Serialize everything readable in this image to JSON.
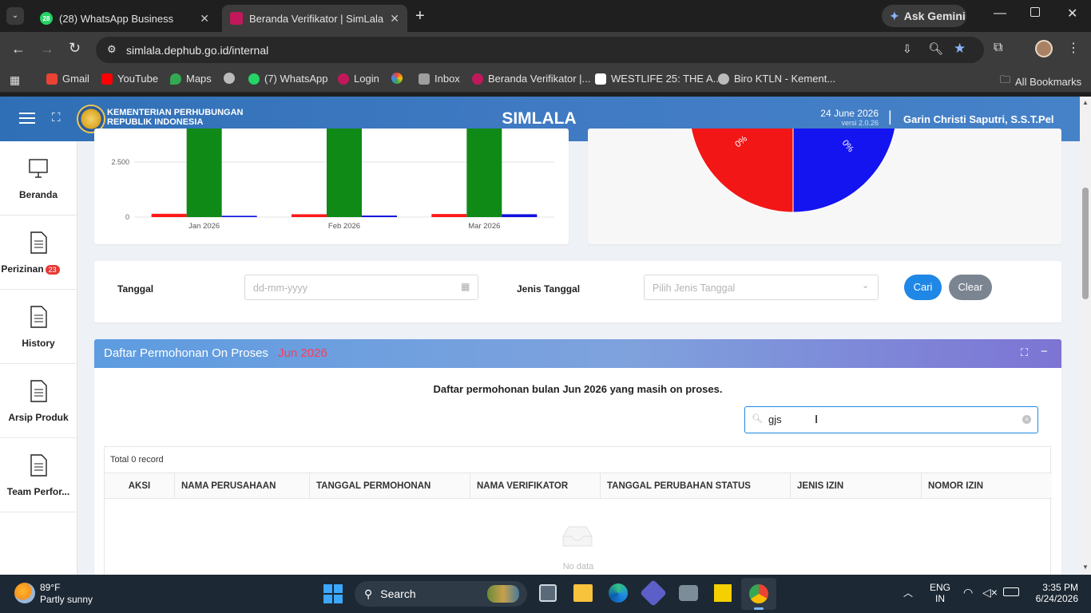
{
  "browser": {
    "tabs": [
      {
        "label": "(28) WhatsApp Business",
        "badge": "28",
        "active": false
      },
      {
        "label": "Beranda Verifikator | SimLala",
        "active": true
      }
    ],
    "ask_gemini": "Ask Gemini",
    "url": "simlala.dephub.go.id/internal",
    "bookmarks": [
      {
        "label": "Gmail",
        "icon": "gmail-icon",
        "color": "#ea4335"
      },
      {
        "label": "YouTube",
        "icon": "youtube-icon",
        "color": "#ff0000"
      },
      {
        "label": "Maps",
        "icon": "maps-icon",
        "color": "#34a853"
      },
      {
        "label": "",
        "icon": "globe-icon",
        "color": "#bbbbbb"
      },
      {
        "label": "(7) WhatsApp",
        "icon": "whatsapp-icon",
        "color": "#25d366",
        "badge": "28"
      },
      {
        "label": "Login",
        "icon": "login-icon",
        "color": "#c2185b"
      },
      {
        "label": "",
        "icon": "pinwheel-icon",
        "color": "#fbbc04"
      },
      {
        "label": "Inbox",
        "icon": "inbox-icon",
        "color": "#9e9e9e"
      },
      {
        "label": "Beranda Verifikator |...",
        "icon": "simlala-icon",
        "color": "#c2185b"
      },
      {
        "label": "WESTLIFE 25: THE A...",
        "icon": "page-icon",
        "color": "#ffffff"
      },
      {
        "label": "Biro KTLN - Kement...",
        "icon": "globe-icon",
        "color": "#bbbbbb"
      }
    ],
    "all_bookmarks": "All Bookmarks"
  },
  "app": {
    "org_line1": "KEMENTERIAN PERHUBUNGAN",
    "org_line2": "REPUBLIK INDONESIA",
    "title": "SIMLALA",
    "date": "24 June 2026",
    "version": "versi 2.0.26",
    "separator": "|",
    "user": "Garin Christi Saputri, S.S.T.Pel"
  },
  "sidebar": {
    "items": [
      {
        "label": "Beranda",
        "icon": "monitor-icon"
      },
      {
        "label": "Perizinan",
        "icon": "document-icon",
        "badge": "23"
      },
      {
        "label": "History",
        "icon": "document-icon"
      },
      {
        "label": "Arsip Produk",
        "icon": "document-icon"
      },
      {
        "label": "Team Perfor...",
        "icon": "document-icon"
      }
    ]
  },
  "chart_data": [
    {
      "type": "bar",
      "categories": [
        "Jan 2026",
        "Feb 2026",
        "Mar 2026"
      ],
      "series": [
        {
          "name": "",
          "color": "#ff1a1a",
          "values": [
            150,
            130,
            140
          ]
        },
        {
          "name": "",
          "color": "#0f8a16",
          "values": [
            5000,
            5000,
            5000
          ]
        },
        {
          "name": "",
          "color": "#1010e0",
          "values": [
            60,
            70,
            130
          ]
        }
      ],
      "ytick_labels": [
        "0",
        "2.500"
      ],
      "yticks": [
        0,
        2500
      ],
      "ylim": [
        0,
        5000
      ],
      "grid": true
    },
    {
      "type": "pie",
      "labels": [
        "0%",
        "0%"
      ],
      "colors": [
        "#f21616",
        "#1414f0"
      ]
    }
  ],
  "filter": {
    "tanggal_label": "Tanggal",
    "tanggal_placeholder": "dd-mm-yyyy",
    "jenis_label": "Jenis Tanggal",
    "jenis_placeholder": "Pilih Jenis Tanggal",
    "search_btn": "Cari",
    "clear_btn": "Clear"
  },
  "panel": {
    "title": "Daftar Permohonan On Proses",
    "period": "Jun 2026",
    "description": "Daftar permohonan bulan Jun 2026 yang masih on proses.",
    "search_value": "gjs",
    "total": "Total 0 record",
    "columns": [
      "AKSI",
      "NAMA PERUSAHAAN",
      "TANGGAL PERMOHONAN",
      "NAMA VERIFIKATOR",
      "TANGGAL PERUBAHAN STATUS",
      "JENIS IZIN",
      "NOMOR IZIN"
    ],
    "empty": "No data"
  },
  "taskbar": {
    "temp": "89°F",
    "weather": "Partly sunny",
    "search": "Search",
    "lang1": "ENG",
    "lang2": "IN",
    "time": "3:35 PM",
    "date": "6/24/2026"
  }
}
